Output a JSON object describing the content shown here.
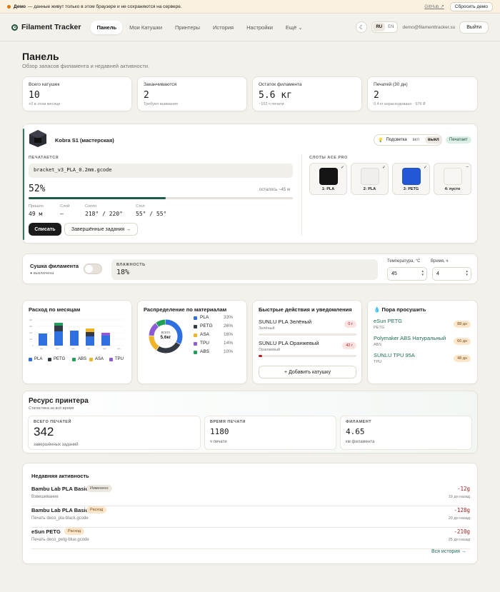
{
  "demo": {
    "bold": "Демо",
    "text": "— данные живут только в этом браузере и не сохраняются на сервере.",
    "github": "GitHub ↗",
    "reset": "Сбросить демо"
  },
  "nav": {
    "brand": "Filament Tracker",
    "tabs": [
      "Панель",
      "Мои Катушки",
      "Принтеры",
      "История",
      "Настройки",
      "Ещё"
    ],
    "lang": [
      "RU",
      "EN"
    ],
    "email": "demo@filamenttracker.su",
    "logout": "Выйти",
    "theme_icon": "moon-icon"
  },
  "page": {
    "title": "Панель",
    "subtitle": "Обзор запасов филамента и недавней активности."
  },
  "stats": [
    {
      "label": "Всего катушек",
      "value": "10",
      "hint": "+0 в этом месяце"
    },
    {
      "label": "Заканчиваются",
      "value": "2",
      "hint": "Требуют внимания"
    },
    {
      "label": "Остаток филамента",
      "value": "5.6 кг",
      "hint": "~102 ч печати"
    },
    {
      "label": "Печатей (30 дн)",
      "value": "2",
      "hint": "0.4 кг израсходовано · 576 ₽"
    }
  ],
  "printer": {
    "name": "Kobra S1 (мастерская)",
    "light_label": "Подсветка",
    "light_on": "вкл",
    "light_off": "выкл",
    "status": "Печатает",
    "printing_caption": "ПЕЧАТАЕТСЯ",
    "file": "bracket_v3_PLA_0.2mm.gcode",
    "percent": "52%",
    "progress": 0.52,
    "remaining": "осталось ~45 м",
    "metrics": [
      {
        "k": "Прошло",
        "v": "49 м"
      },
      {
        "k": "Слой",
        "v": "—"
      },
      {
        "k": "Сопло",
        "v": "218° / 220°"
      },
      {
        "k": "Стол",
        "v": "55° / 55°"
      }
    ],
    "cancel": "Списать",
    "jobs": "Завершённые задания →",
    "ace_caption": "СЛОТЫ ACE PRO",
    "slots": [
      {
        "label": "1: PLA",
        "color": "#141414",
        "mark": "✓"
      },
      {
        "label": "2: PLA",
        "color": "#f1efeb",
        "mark": "✓"
      },
      {
        "label": "3: PETG",
        "color": "#2357d6",
        "mark": "✓"
      },
      {
        "label": "4: пусто",
        "color": "#f7f6f2",
        "mark": "–"
      }
    ]
  },
  "dryer": {
    "title": "Сушка филамента",
    "state": "выключена",
    "humidity_caption": "ВЛАЖНОСТЬ",
    "humidity": "18%",
    "temp_label": "Температура, °C",
    "temp": "45",
    "time_label": "Время, ч",
    "time": "4"
  },
  "monthly": {
    "title": "Расход по месяцам",
    "legend": [
      {
        "n": "PLA",
        "c": "#2f6fe0"
      },
      {
        "n": "PETG",
        "c": "#333a44"
      },
      {
        "n": "ABS",
        "c": "#22a05a"
      },
      {
        "n": "ASA",
        "c": "#f0b429"
      },
      {
        "n": "TPU",
        "c": "#8e5bd6"
      }
    ]
  },
  "materials": {
    "title": "Распределение по материалам",
    "center_top": "всего",
    "center_value": "5.6кг",
    "rows": [
      {
        "n": "PLA",
        "p": "33%",
        "c": "#2f6fe0",
        "v": 33
      },
      {
        "n": "PETG",
        "p": "26%",
        "c": "#333a44",
        "v": 26
      },
      {
        "n": "ASA",
        "p": "16%",
        "c": "#f0b429",
        "v": 16
      },
      {
        "n": "TPU",
        "p": "14%",
        "c": "#8e5bd6",
        "v": 14
      },
      {
        "n": "ABS",
        "p": "10%",
        "c": "#22a05a",
        "v": 10
      }
    ]
  },
  "quick": {
    "title": "Быстрые действия и уведомления",
    "items": [
      {
        "n": "SUNLU PLA Зелёный",
        "c": "Зелёный",
        "badge": "0 г",
        "fill": 0
      },
      {
        "n": "SUNLU PLA Оранжевый",
        "c": "Оранжевый",
        "badge": "42 г",
        "fill": 0.04
      }
    ],
    "add": "+ Добавить катушку"
  },
  "buy": {
    "title": "Пора просушить",
    "items": [
      {
        "n": "eSun PETG",
        "c": "PETG",
        "badge": "88 дн"
      },
      {
        "n": "Polymaker ABS Натуральный",
        "c": "ABS",
        "badge": "66 дн"
      },
      {
        "n": "SUNLU TPU 95A",
        "c": "TPU",
        "badge": "48 дн"
      }
    ]
  },
  "resource": {
    "title": "Ресурс принтера",
    "subtitle": "Статистика за всё время",
    "boxes": [
      {
        "c": "ВСЕГО ПЕЧАТЕЙ",
        "v": "342",
        "h": "завершённых заданий"
      },
      {
        "c": "ВРЕМЯ ПЕЧАТИ",
        "v": "1180",
        "h": "ч печати"
      },
      {
        "c": "ФИЛАМЕНТ",
        "v": "4.65",
        "h": "км филамента"
      }
    ]
  },
  "activity": {
    "title": "Недавняя активность",
    "rows": [
      {
        "n": "Bambu Lab PLA Basic",
        "tag": "Изменено",
        "d": "Взвешивание",
        "g": "-12g",
        "w": "19 дн назад",
        "tagbg": "#ece8df",
        "tagfg": "#444"
      },
      {
        "n": "Bambu Lab PLA Basic",
        "tag": "Расход",
        "d": "Печать deco_pla-black.gcode",
        "g": "-128g",
        "w": "20 дн назад",
        "tagbg": "#fbe6cc",
        "tagfg": "#7a4a12"
      },
      {
        "n": "eSun PETG",
        "tag": "Расход",
        "d": "Печать deco_petg-blue.gcode",
        "g": "-210g",
        "w": "25 дн назад",
        "tagbg": "#fbe6cc",
        "tagfg": "#7a4a12"
      }
    ],
    "all": "Вся история →"
  }
}
